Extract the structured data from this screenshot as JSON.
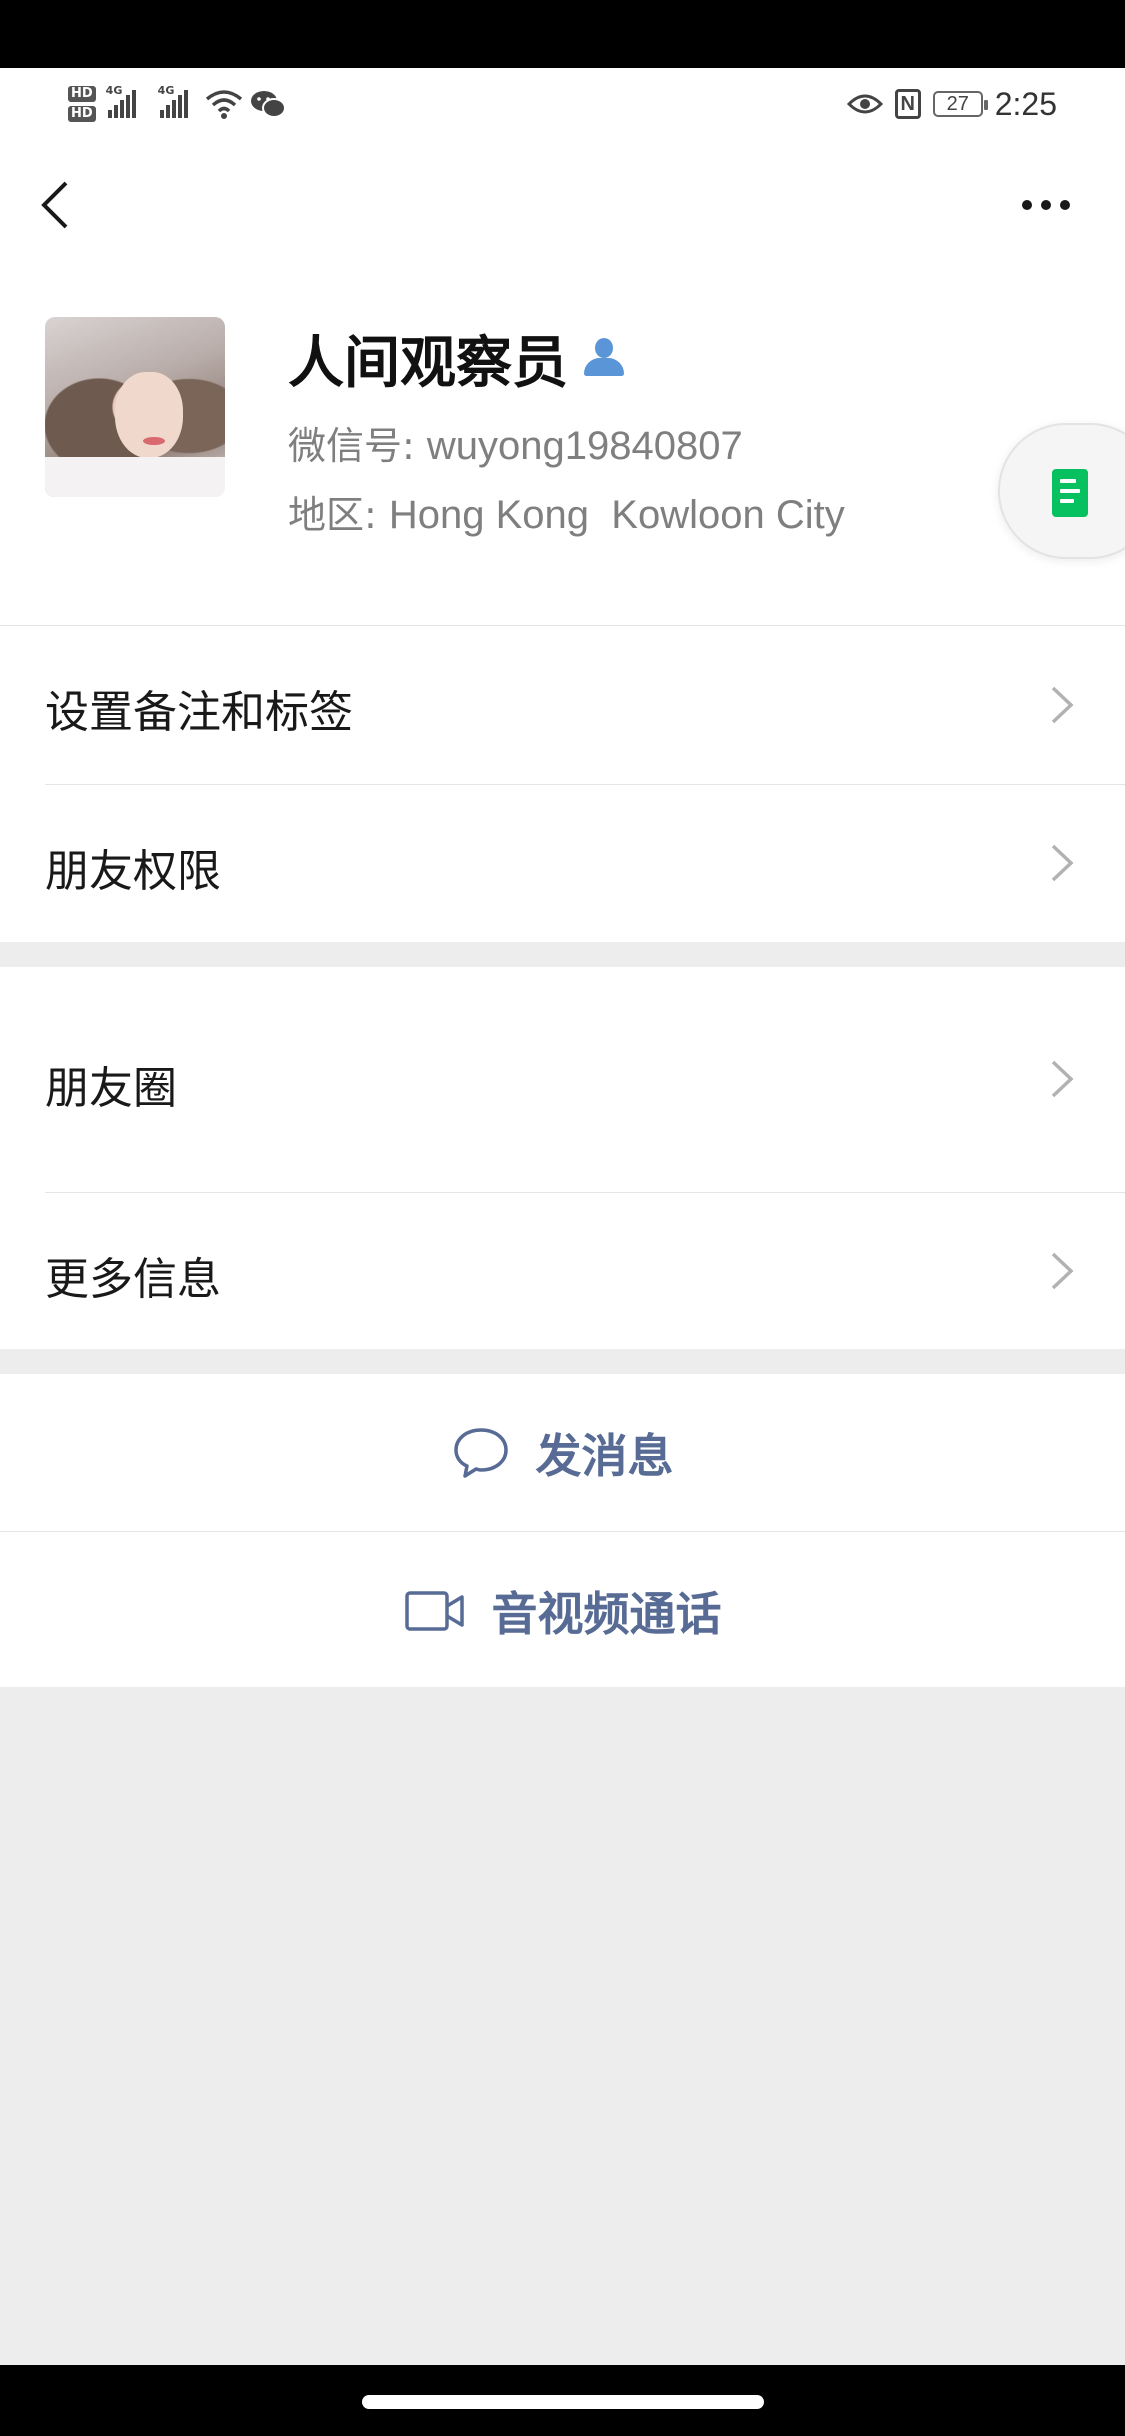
{
  "status_bar": {
    "hd1": "HD",
    "hd2": "HD",
    "net1": "4G",
    "net2": "4G",
    "battery": "27",
    "nfc": "N",
    "time": "2:25",
    "icons": [
      "signal-icon",
      "wifi-icon",
      "wechat-icon",
      "eye-icon",
      "nfc-icon",
      "battery-icon"
    ]
  },
  "nav": {
    "back_icon": "chevron-left-icon",
    "more_icon": "more-dots-icon"
  },
  "profile": {
    "name": "人间观察员",
    "wechat_id_label": "微信号: ",
    "wechat_id": "wuyong19840807",
    "region_label": "地区: ",
    "region": "Hong Kong  Kowloon City",
    "badge_icon": "person-icon",
    "float_icon": "document-icon"
  },
  "menu_group1": [
    {
      "label": "设置备注和标签"
    },
    {
      "label": "朋友权限"
    }
  ],
  "menu_group2": [
    {
      "label": "朋友圈"
    },
    {
      "label": "更多信息"
    }
  ],
  "actions": [
    {
      "label": "发消息",
      "icon": "chat-bubble-icon"
    },
    {
      "label": "音视频通话",
      "icon": "video-camera-icon"
    }
  ],
  "colors": {
    "link": "#576b95",
    "accent_green": "#07c160",
    "badge_blue": "#5a95d8",
    "background": "#ededed"
  }
}
